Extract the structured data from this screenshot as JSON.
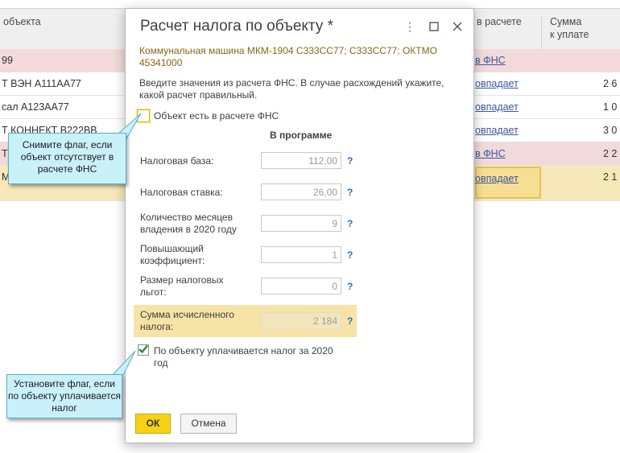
{
  "table": {
    "headers": {
      "object": "объекта",
      "in_calc": "в расчете",
      "sum_to_pay_line1": "Сумма",
      "sum_to_pay_line2": "к уплате"
    },
    "rows": [
      {
        "object": "99",
        "status": "в ФНС",
        "sum": "",
        "style": "pink"
      },
      {
        "object": "Т ВЭН А111АА77",
        "status": "овпадает",
        "sum": "2 6",
        "style": "white"
      },
      {
        "object": "сал А123АА77",
        "status": "овпадает",
        "sum": "1 0",
        "style": "white"
      },
      {
        "object": "Т КОННЕКТ В222ВВ",
        "status": "овпадает",
        "sum": "3 0",
        "style": "white"
      },
      {
        "object": "Т",
        "status": "в ФНС",
        "sum": "2 2",
        "style": "pink"
      },
      {
        "object": "М",
        "status": "овпадает",
        "sum": "2 1",
        "style": "yellow"
      }
    ]
  },
  "dialog": {
    "title": "Расчет налога по объекту *",
    "subtitle": "Коммунальная машина МКМ-1904 С333СС77; С333СС77; ОКТМО 45341000",
    "hint": "Введите значения из расчета ФНС. В случае расхождений укажите, какой расчет правильный.",
    "object_in_fns_label": "Объект есть в расчете ФНС",
    "object_in_fns_checked": false,
    "column_header": "В программе",
    "fields": [
      {
        "label": "Налоговая база:",
        "value": "112,00"
      },
      {
        "label": "Налоговая ставка:",
        "value": "26,00"
      },
      {
        "label": "Количество месяцев владения в 2020 году",
        "value": "9"
      },
      {
        "label": "Повышающий коэффициент:",
        "value": "1"
      },
      {
        "label": "Размер налоговых льгот:",
        "value": "0"
      },
      {
        "label": "Сумма исчисленного налога:",
        "value": "2 184"
      }
    ],
    "help_mark": "?",
    "pays_tax_label": "По объекту уплачивается налог за 2020 год",
    "pays_tax_checked": true,
    "ok_label": "ОК",
    "cancel_label": "Отмена",
    "icons": {
      "menu": "more-vertical-icon",
      "maximize": "maximize-icon",
      "close": "close-icon"
    }
  },
  "callouts": {
    "uncheck_hint": "Снимите флаг, если объект отсутствует в расчете ФНС",
    "check_hint": "Установите флаг, если по объекту уплачивается налог"
  },
  "colors": {
    "accent": "#f6d215",
    "highlight": "#f7e3a5",
    "link": "#3a56a6",
    "callout_bg": "#c9f1fa",
    "pink_row": "#f2d9da"
  }
}
